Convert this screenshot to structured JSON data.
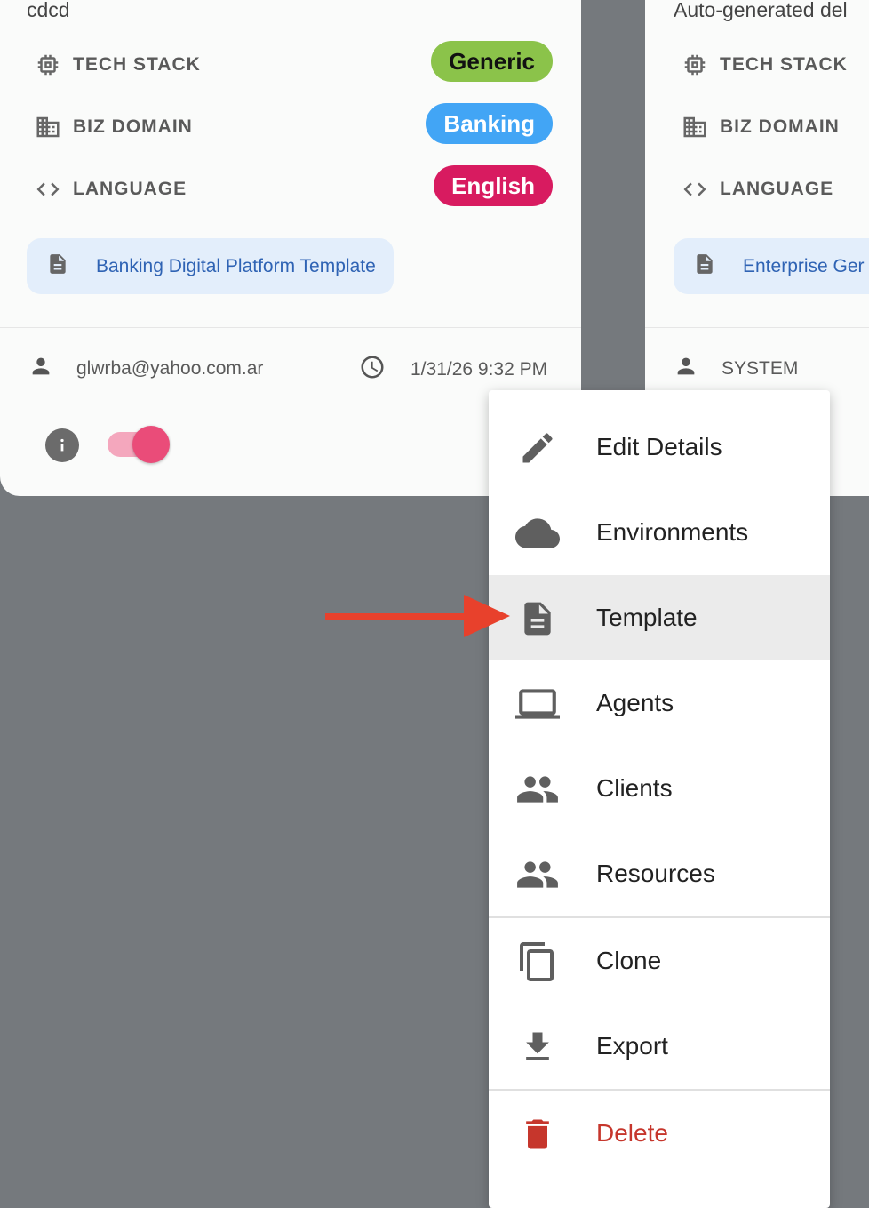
{
  "cards": [
    {
      "description": "cdcd",
      "rows": [
        {
          "label": "TECH STACK",
          "chip": "Generic",
          "chip_bg": "#8bc34a",
          "chip_fg": "#111111"
        },
        {
          "label": "BIZ DOMAIN",
          "chip": "Banking",
          "chip_bg": "#42a5f5",
          "chip_fg": "#ffffff"
        },
        {
          "label": "LANGUAGE",
          "chip": "English",
          "chip_bg": "#d81b60",
          "chip_fg": "#ffffff"
        }
      ],
      "template": "Banking Digital Platform Template",
      "owner": "glwrba@yahoo.com.ar",
      "timestamp": "1/31/26 9:32 PM",
      "toggle_on": true
    },
    {
      "description": "Auto-generated del",
      "rows": [
        {
          "label": "TECH STACK"
        },
        {
          "label": "BIZ DOMAIN"
        },
        {
          "label": "LANGUAGE"
        }
      ],
      "template": "Enterprise Ger",
      "owner": "SYSTEM"
    }
  ],
  "menu": {
    "items": [
      {
        "label": "Edit Details",
        "icon": "pencil-icon"
      },
      {
        "label": "Environments",
        "icon": "cloud-icon"
      },
      {
        "label": "Template",
        "icon": "document-icon",
        "active": true
      },
      {
        "label": "Agents",
        "icon": "laptop-icon"
      },
      {
        "label": "Clients",
        "icon": "people-icon"
      },
      {
        "label": "Resources",
        "icon": "people-icon"
      },
      {
        "label": "Clone",
        "icon": "copy-icon"
      },
      {
        "label": "Export",
        "icon": "download-icon"
      },
      {
        "label": "Delete",
        "icon": "trash-icon",
        "danger": true
      }
    ]
  },
  "colors": {
    "backdrop": "#75797d",
    "arrow": "#e8412c",
    "delete": "#c6362c",
    "link": "#2f63b4",
    "toggle": "#ea4c79"
  }
}
